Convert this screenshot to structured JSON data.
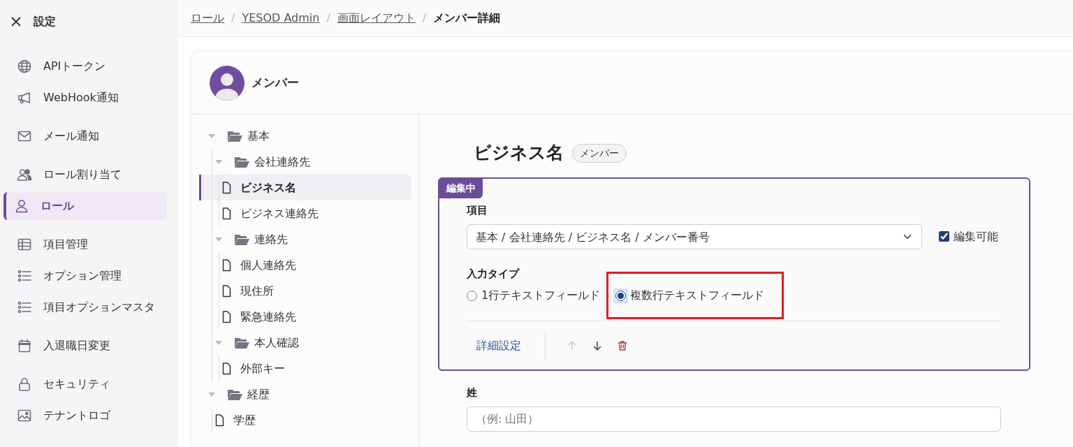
{
  "sidebar": {
    "title": "設定",
    "groups": [
      [
        {
          "label": "APIトークン",
          "selected": false
        },
        {
          "label": "WebHook通知",
          "selected": false
        }
      ],
      [
        {
          "label": "メール通知",
          "selected": false
        }
      ],
      [
        {
          "label": "ロール割り当て",
          "selected": false
        },
        {
          "label": "ロール",
          "selected": true
        }
      ],
      [
        {
          "label": "項目管理",
          "selected": false
        },
        {
          "label": "オプション管理",
          "selected": false
        },
        {
          "label": "項目オプションマスタ",
          "selected": false
        }
      ],
      [
        {
          "label": "入退職日変更",
          "selected": false
        }
      ],
      [
        {
          "label": "セキュリティ",
          "selected": false
        },
        {
          "label": "テナントロゴ",
          "selected": false
        }
      ]
    ]
  },
  "breadcrumb_separator": "/",
  "breadcrumb": [
    {
      "label": "ロール",
      "current": false
    },
    {
      "label": "YESOD Admin",
      "current": false
    },
    {
      "label": "画面レイアウト",
      "current": false
    },
    {
      "label": "メンバー詳細",
      "current": true
    }
  ],
  "card": {
    "title": "メンバー"
  },
  "tree": [
    {
      "label": "基本",
      "kind": "folder",
      "expanded": true,
      "selected": false,
      "children": [
        {
          "label": "会社連絡先",
          "kind": "folder",
          "expanded": true,
          "selected": false,
          "children": [
            {
              "label": "ビジネス名",
              "kind": "file",
              "selected": true
            },
            {
              "label": "ビジネス連絡先",
              "kind": "file",
              "selected": false
            }
          ]
        },
        {
          "label": "連絡先",
          "kind": "folder",
          "expanded": true,
          "selected": false,
          "children": [
            {
              "label": "個人連絡先",
              "kind": "file",
              "selected": false
            },
            {
              "label": "現住所",
              "kind": "file",
              "selected": false
            },
            {
              "label": "緊急連絡先",
              "kind": "file",
              "selected": false
            }
          ]
        },
        {
          "label": "本人確認",
          "kind": "folder",
          "expanded": true,
          "selected": false,
          "children": [
            {
              "label": "外部キー",
              "kind": "file",
              "selected": false
            }
          ]
        }
      ]
    },
    {
      "label": "経歴",
      "kind": "folder",
      "expanded": true,
      "selected": false,
      "children": [
        {
          "label": "学歴",
          "kind": "file",
          "selected": false
        }
      ]
    }
  ],
  "detail": {
    "title": "ビジネス名",
    "badge": "メンバー",
    "editor": {
      "tag": "編集中",
      "field_label": "項目",
      "field_value": "基本 / 会社連絡先 / ビジネス名 / メンバー番号",
      "editable": {
        "label": "編集可能",
        "checked": true
      },
      "input_type_label": "入力タイプ",
      "input_types": [
        {
          "label": "1行テキストフィールド",
          "selected": false,
          "highlighted": false
        },
        {
          "label": "複数行テキストフィールド",
          "selected": true,
          "highlighted": true
        }
      ],
      "settings_link": "詳細設定",
      "move_up_disabled": true,
      "move_down_disabled": false
    },
    "next_field": {
      "label": "姓",
      "placeholder": "（例: 山田）"
    }
  }
}
